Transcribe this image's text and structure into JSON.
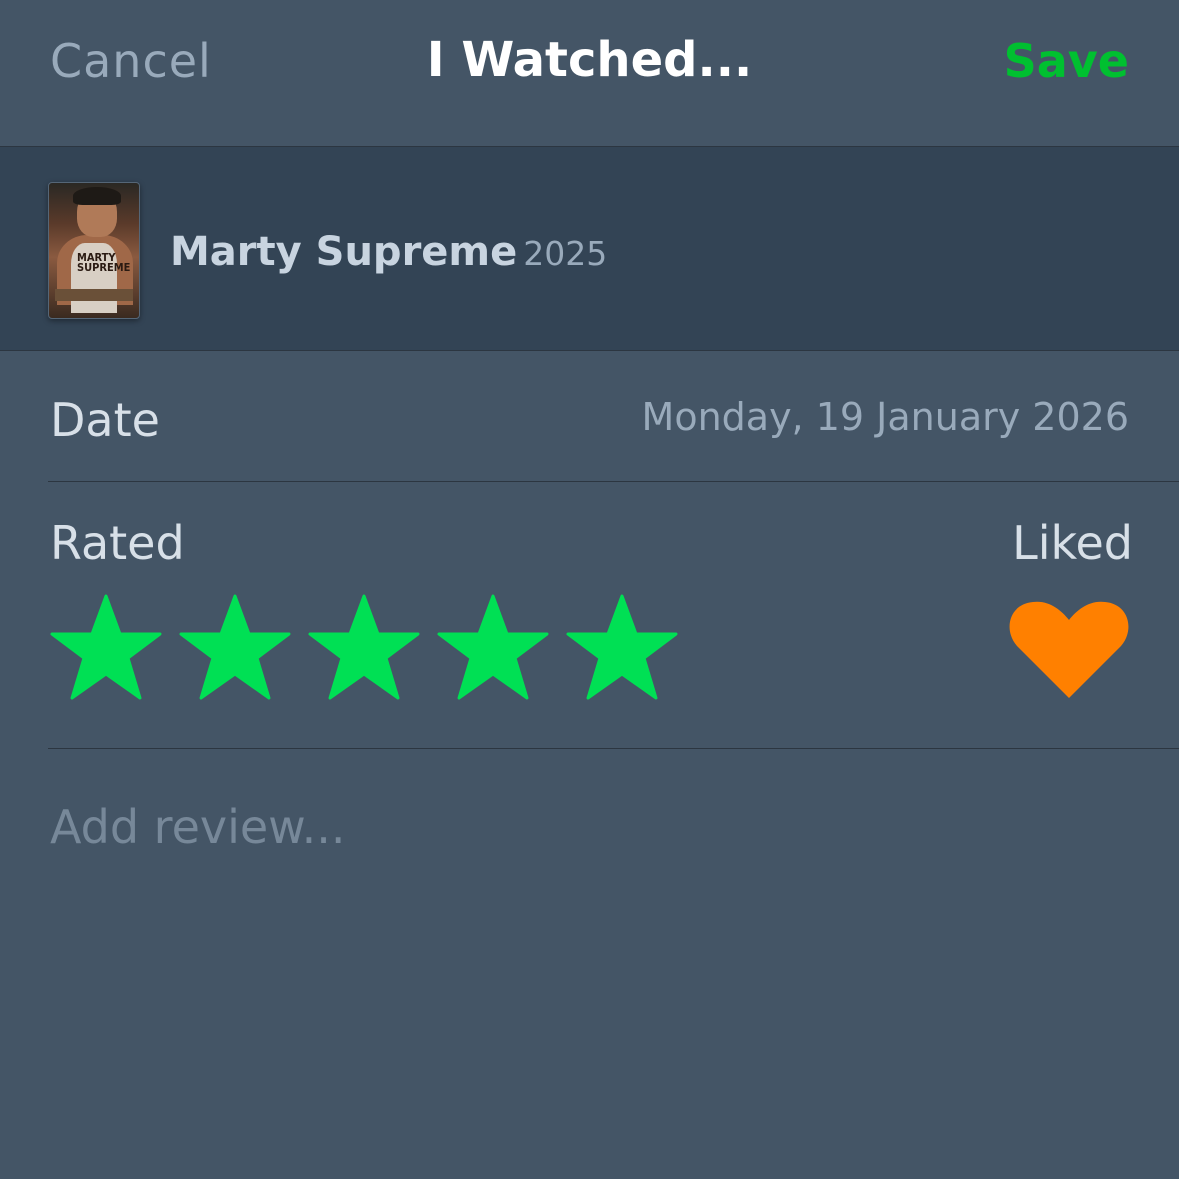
{
  "nav": {
    "cancel_label": "Cancel",
    "title": "I Watched...",
    "save_label": "Save"
  },
  "film": {
    "title": "Marty Supreme",
    "year": "2025",
    "poster_text": "MARTY SUPREME"
  },
  "date": {
    "label": "Date",
    "value": "Monday, 19 January 2026"
  },
  "rating": {
    "label": "Rated",
    "stars": 5,
    "max_stars": 5,
    "liked_label": "Liked",
    "liked": true
  },
  "review": {
    "placeholder": "Add review..."
  },
  "colors": {
    "background": "#445566",
    "film_row": "#334455",
    "accent_green": "#00c030",
    "star_green": "#00e054",
    "heart_orange": "#ff8000"
  }
}
